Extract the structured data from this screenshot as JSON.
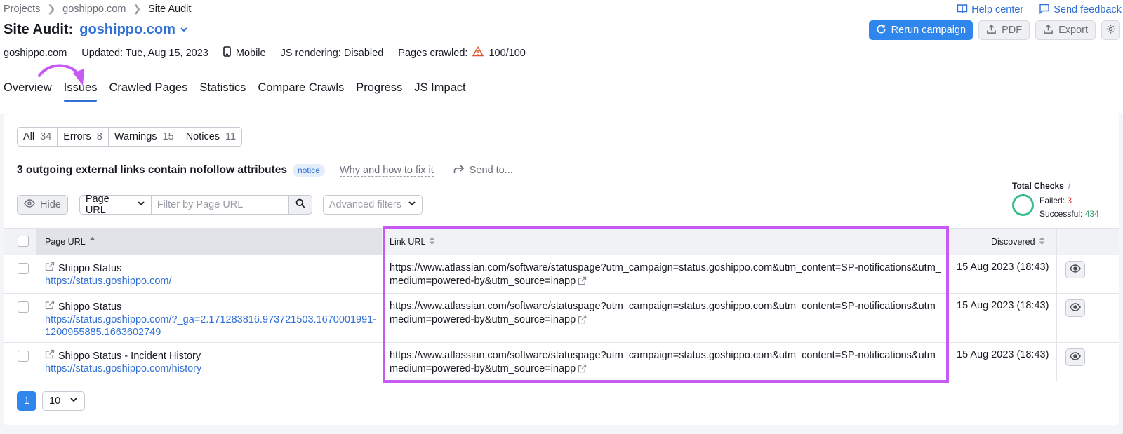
{
  "breadcrumbs": [
    "Projects",
    "goshippo.com",
    "Site Audit"
  ],
  "header_links": {
    "help": "Help center",
    "feedback": "Send feedback"
  },
  "title": {
    "label": "Site Audit:",
    "project": "goshippo.com"
  },
  "actions": {
    "rerun": "Rerun campaign",
    "pdf": "PDF",
    "export": "Export"
  },
  "meta": {
    "domain": "goshippo.com",
    "updated": "Updated: Tue, Aug 15, 2023",
    "device": "Mobile",
    "js": "JS rendering: Disabled",
    "pages_label": "Pages crawled:",
    "pages_value": "100/100"
  },
  "tabs": [
    "Overview",
    "Issues",
    "Crawled Pages",
    "Statistics",
    "Compare Crawls",
    "Progress",
    "JS Impact"
  ],
  "filters": [
    {
      "label": "All",
      "count": "34"
    },
    {
      "label": "Errors",
      "count": "8"
    },
    {
      "label": "Warnings",
      "count": "15"
    },
    {
      "label": "Notices",
      "count": "11"
    }
  ],
  "issue": {
    "title": "3 outgoing external links contain nofollow attributes",
    "badge": "notice",
    "why": "Why and how to fix it",
    "send": "Send to..."
  },
  "controls": {
    "hide": "Hide",
    "select_value": "Page URL",
    "search_placeholder": "Filter by Page URL",
    "advanced": "Advanced filters"
  },
  "totals": {
    "title": "Total Checks",
    "failed_label": "Failed:",
    "failed": "3",
    "success_label": "Successful:",
    "success": "434"
  },
  "table": {
    "headers": {
      "page": "Page URL",
      "link": "Link URL",
      "discovered": "Discovered"
    },
    "rows": [
      {
        "title": "Shippo Status",
        "url": "https://status.goshippo.com/",
        "link": "https://www.atlassian.com/software/statuspage?utm_campaign=status.goshippo.com&utm_content=SP-notifications&utm_medium=powered-by&utm_source=inapp",
        "date": "15 Aug 2023 (18:43)"
      },
      {
        "title": "Shippo Status",
        "url": "https://status.goshippo.com/?_ga=2.171283816.973721503.1670001991-1200955885.1663602749",
        "link": "https://www.atlassian.com/software/statuspage?utm_campaign=status.goshippo.com&utm_content=SP-notifications&utm_medium=powered-by&utm_source=inapp",
        "date": "15 Aug 2023 (18:43)"
      },
      {
        "title": "Shippo Status - Incident History",
        "url": "https://status.goshippo.com/history",
        "link": "https://www.atlassian.com/software/statuspage?utm_campaign=status.goshippo.com&utm_content=SP-notifications&utm_medium=powered-by&utm_source=inapp",
        "date": "15 Aug 2023 (18:43)"
      }
    ]
  },
  "pagination": {
    "page": "1",
    "size": "10"
  },
  "colors": {
    "accent": "#2f86ec",
    "link": "#2f6fd6",
    "highlight": "#c75af3",
    "failed": "#d1312e",
    "success": "#3e9e6c"
  }
}
